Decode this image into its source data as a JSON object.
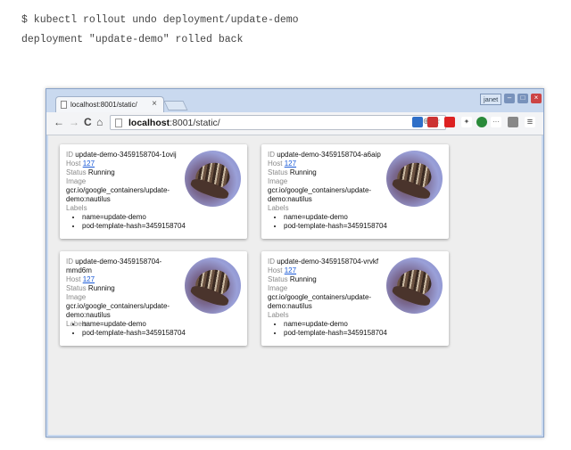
{
  "terminal": {
    "line1": "$ kubectl rollout undo deployment/update-demo",
    "line2": "deployment \"update-demo\" rolled back"
  },
  "browser": {
    "tab_title": "localhost:8001/static/",
    "tab_close": "×",
    "user": "janet",
    "window_buttons": [
      "–",
      "□",
      "×"
    ],
    "nav": {
      "back": "←",
      "forward": "→",
      "reload": "C",
      "home": "⌂"
    },
    "url_host": "localhost",
    "url_rest": ":8001/static/",
    "omnibox_icons": "⊕ ☆"
  },
  "pods": [
    {
      "id_label": "ID",
      "id": "update-demo-3459158704-1ovij",
      "host_label": "Host",
      "host": "127",
      "status_label": "Status",
      "status": "Running",
      "image_label": "Image",
      "image": "gcr.io/google_containers/update-demo:nautilus",
      "labels_label": "Labels",
      "labels": [
        "name=update-demo",
        "pod-template-hash=3459158704"
      ]
    },
    {
      "id_label": "ID",
      "id": "update-demo-3459158704-a6aip",
      "host_label": "Host",
      "host": "127",
      "status_label": "Status",
      "status": "Running",
      "image_label": "Image",
      "image": "gcr.io/google_containers/update-demo:nautilus",
      "labels_label": "Labels",
      "labels": [
        "name=update-demo",
        "pod-template-hash=3459158704"
      ]
    },
    {
      "id_label": "ID",
      "id": "update-demo-3459158704-mmd6m",
      "host_label": "Host",
      "host": "127",
      "status_label": "Status",
      "status": "Running",
      "image_label": "Image",
      "image": "gcr.io/google_containers/update-demo:nautilus",
      "labels_label": "Labels",
      "labels": [
        "name=update-demo",
        "pod-template-hash=3459158704"
      ]
    },
    {
      "id_label": "ID",
      "id": "update-demo-3459158704-vrvkf",
      "host_label": "Host",
      "host": "127",
      "status_label": "Status",
      "status": "Running",
      "image_label": "Image",
      "image": "gcr.io/google_containers/update-demo:nautilus",
      "labels_label": "Labels",
      "labels": [
        "name=update-demo",
        "pod-template-hash=3459158704"
      ]
    }
  ]
}
